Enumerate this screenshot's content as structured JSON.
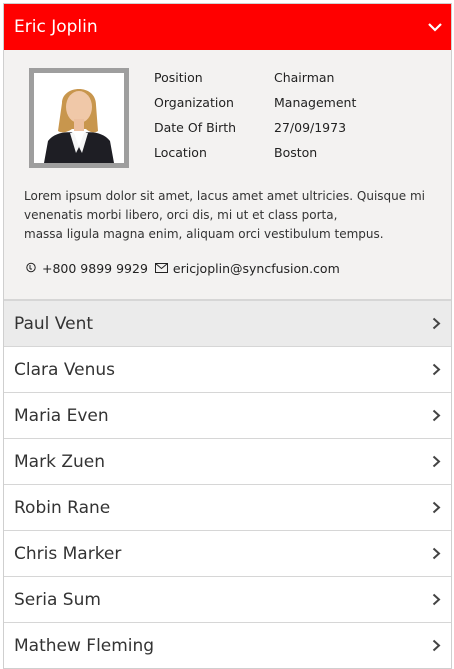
{
  "expanded": {
    "name": "Eric Joplin",
    "fields": [
      {
        "label": "Position",
        "value": "Chairman"
      },
      {
        "label": "Organization",
        "value": "Management"
      },
      {
        "label": "Date Of Birth",
        "value": "27/09/1973"
      },
      {
        "label": "Location",
        "value": "Boston"
      }
    ],
    "description_lines": [
      "Lorem ipsum dolor sit amet, lacus amet amet ultricies. Quisque mi",
      "venenatis morbi libero, orci dis, mi ut et class porta,",
      "massa ligula magna enim, aliquam orci vestibulum tempus."
    ],
    "phone": "+800 9899 9929",
    "email": "ericjoplin@syncfusion.com"
  },
  "items": [
    {
      "name": "Paul Vent"
    },
    {
      "name": "Clara Venus"
    },
    {
      "name": "Maria Even"
    },
    {
      "name": "Mark Zuen"
    },
    {
      "name": "Robin Rane"
    },
    {
      "name": "Chris Marker"
    },
    {
      "name": "Seria Sum"
    },
    {
      "name": "Mathew Fleming"
    }
  ],
  "colors": {
    "header": "#ff0000",
    "content_bg": "#f3f2f1",
    "active_item": "#ebebeb"
  },
  "icons": {
    "expand": "chevron-down-icon",
    "collapsed": "chevron-right-icon",
    "phone": "phone-icon",
    "email": "mail-icon"
  }
}
